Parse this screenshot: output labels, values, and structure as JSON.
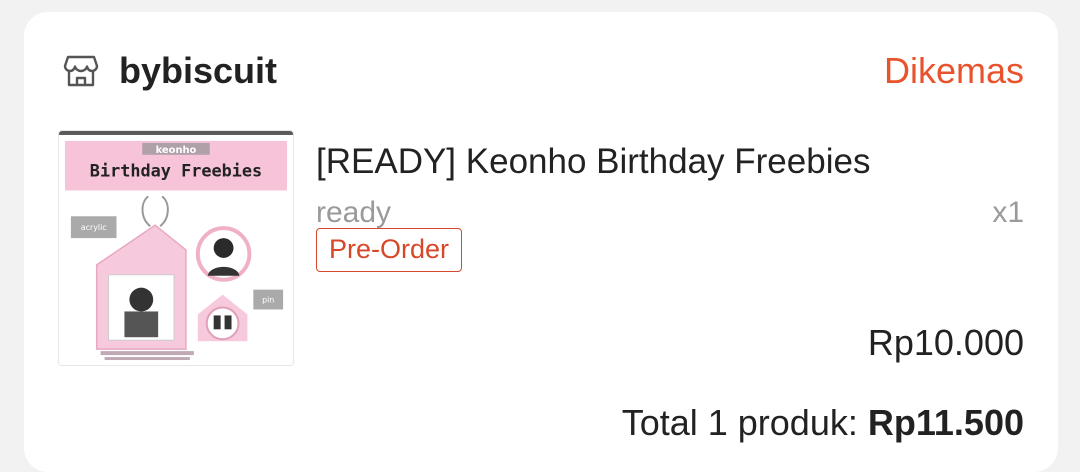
{
  "shop": {
    "name": "bybiscuit",
    "icon": "store-icon",
    "status": "Dikemas"
  },
  "product": {
    "title": "[READY] Keonho Birthday Freebies",
    "variant": "ready",
    "quantity": "x1",
    "badge": "Pre-Order",
    "price": "Rp10.000",
    "thumbnail": {
      "label_top": "keonho",
      "label_main": "Birthday Freebies",
      "label_left": "acrylic",
      "label_right": "pin"
    }
  },
  "summary": {
    "total_label": "Total 1 produk:",
    "total_amount": "Rp11.500"
  },
  "colors": {
    "accent": "#e8532e",
    "badge": "#d7482a",
    "thumb_pink": "#f6c3d9"
  }
}
